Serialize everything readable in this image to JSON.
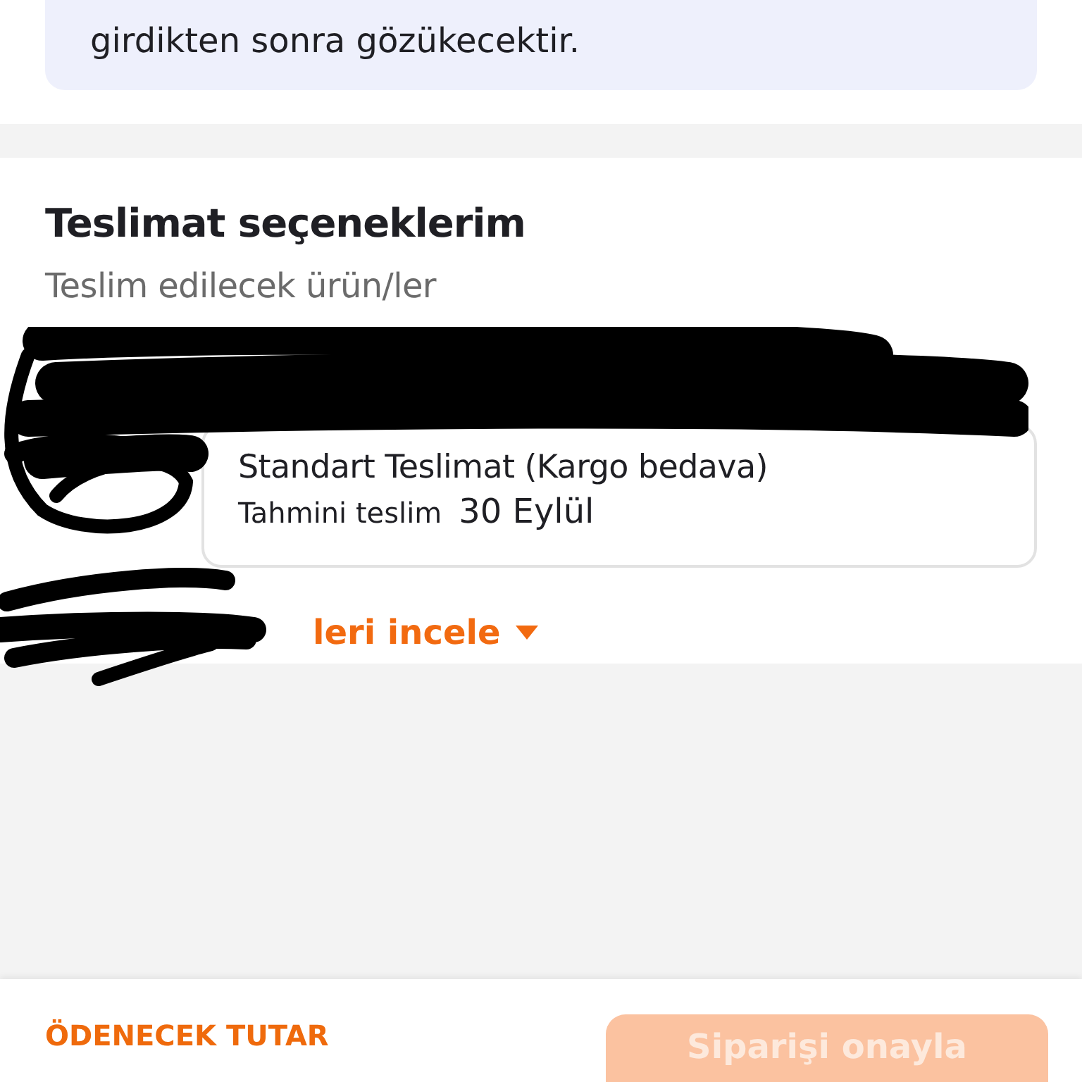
{
  "info_note": {
    "text": "girdikten sonra gözükecektir."
  },
  "delivery": {
    "title": "Teslimat seçeneklerim",
    "subtitle": "Teslim edilecek ürün/ler",
    "option": {
      "name": "Standart Teslimat (Kargo bedava)",
      "estimate_label": "Tahmini teslim",
      "estimate_date": "30 Eylül"
    },
    "link": {
      "label": "leri incele",
      "expanded": false
    }
  },
  "footer": {
    "amount_label": "ÖDENECEK TUTAR",
    "confirm_button": {
      "label": "Siparişi onayla",
      "disabled": true
    }
  }
}
